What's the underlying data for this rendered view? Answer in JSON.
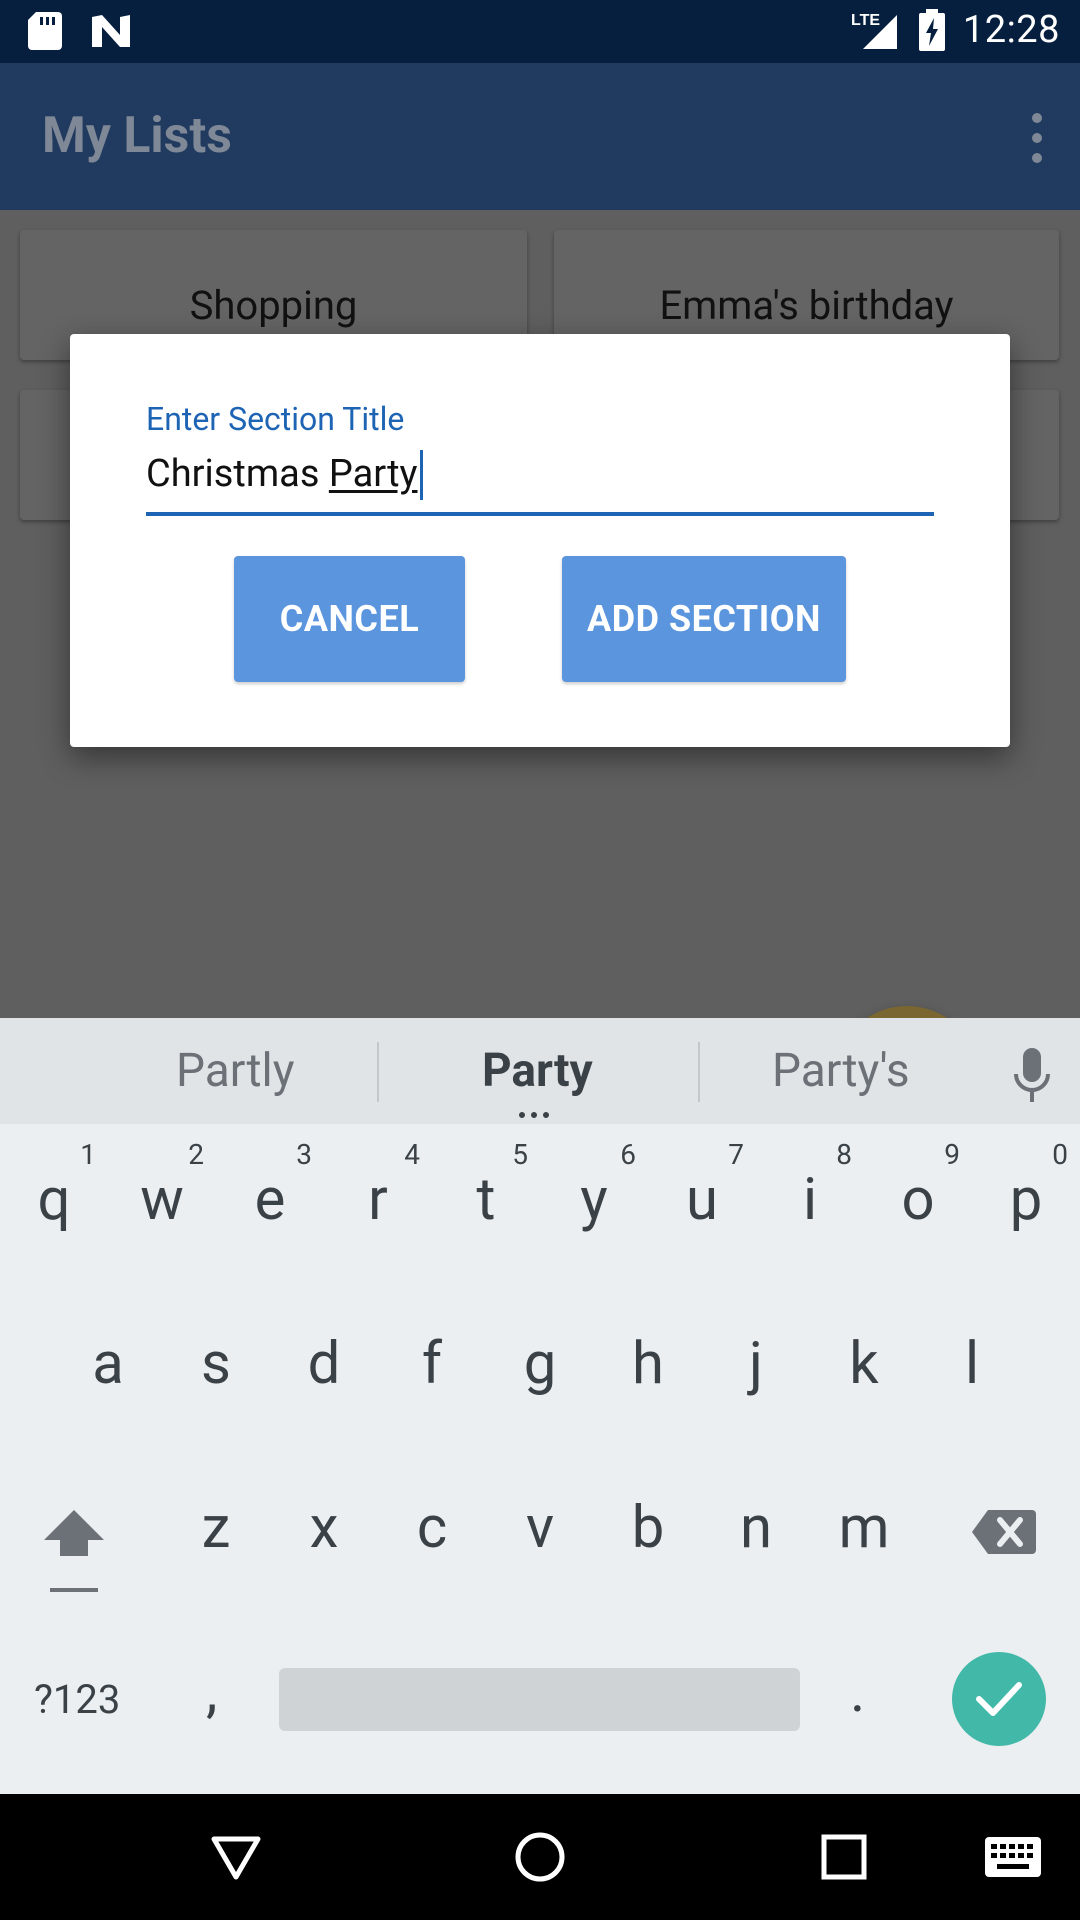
{
  "status_bar": {
    "time": "12:28",
    "network": "LTE",
    "icons": [
      "sd-card-icon",
      "n-logo-icon",
      "signal-icon",
      "battery-charging-icon"
    ]
  },
  "app_bar": {
    "title": "My Lists",
    "menu_icon": "overflow-menu-icon"
  },
  "lists": [
    {
      "label": "Shopping"
    },
    {
      "label": "Emma's birthday"
    },
    {
      "label": ""
    },
    {
      "label": ""
    }
  ],
  "fab": {
    "icon": "plus-icon",
    "glyph": "+"
  },
  "dialog": {
    "label": "Enter Section Title",
    "input_prefix": "Christmas ",
    "input_composing": "Party",
    "cancel_label": "CANCEL",
    "add_label": "ADD SECTION"
  },
  "keyboard": {
    "suggestions": [
      "Partly",
      "Party",
      "Party's"
    ],
    "row1": [
      {
        "ch": "q",
        "num": "1"
      },
      {
        "ch": "w",
        "num": "2"
      },
      {
        "ch": "e",
        "num": "3"
      },
      {
        "ch": "r",
        "num": "4"
      },
      {
        "ch": "t",
        "num": "5"
      },
      {
        "ch": "y",
        "num": "6"
      },
      {
        "ch": "u",
        "num": "7"
      },
      {
        "ch": "i",
        "num": "8"
      },
      {
        "ch": "o",
        "num": "9"
      },
      {
        "ch": "p",
        "num": "0"
      }
    ],
    "row2": [
      "a",
      "s",
      "d",
      "f",
      "g",
      "h",
      "j",
      "k",
      "l"
    ],
    "row3": [
      "z",
      "x",
      "c",
      "v",
      "b",
      "n",
      "m"
    ],
    "symbols_label": "?123",
    "comma": ",",
    "period": ".",
    "colors": {
      "enter": "#42b8a8",
      "accent": "#1e64b4",
      "button": "#5b95dd"
    }
  },
  "nav_bar": {
    "icons": [
      "back-icon",
      "home-icon",
      "recents-icon",
      "keyboard-icon"
    ]
  }
}
